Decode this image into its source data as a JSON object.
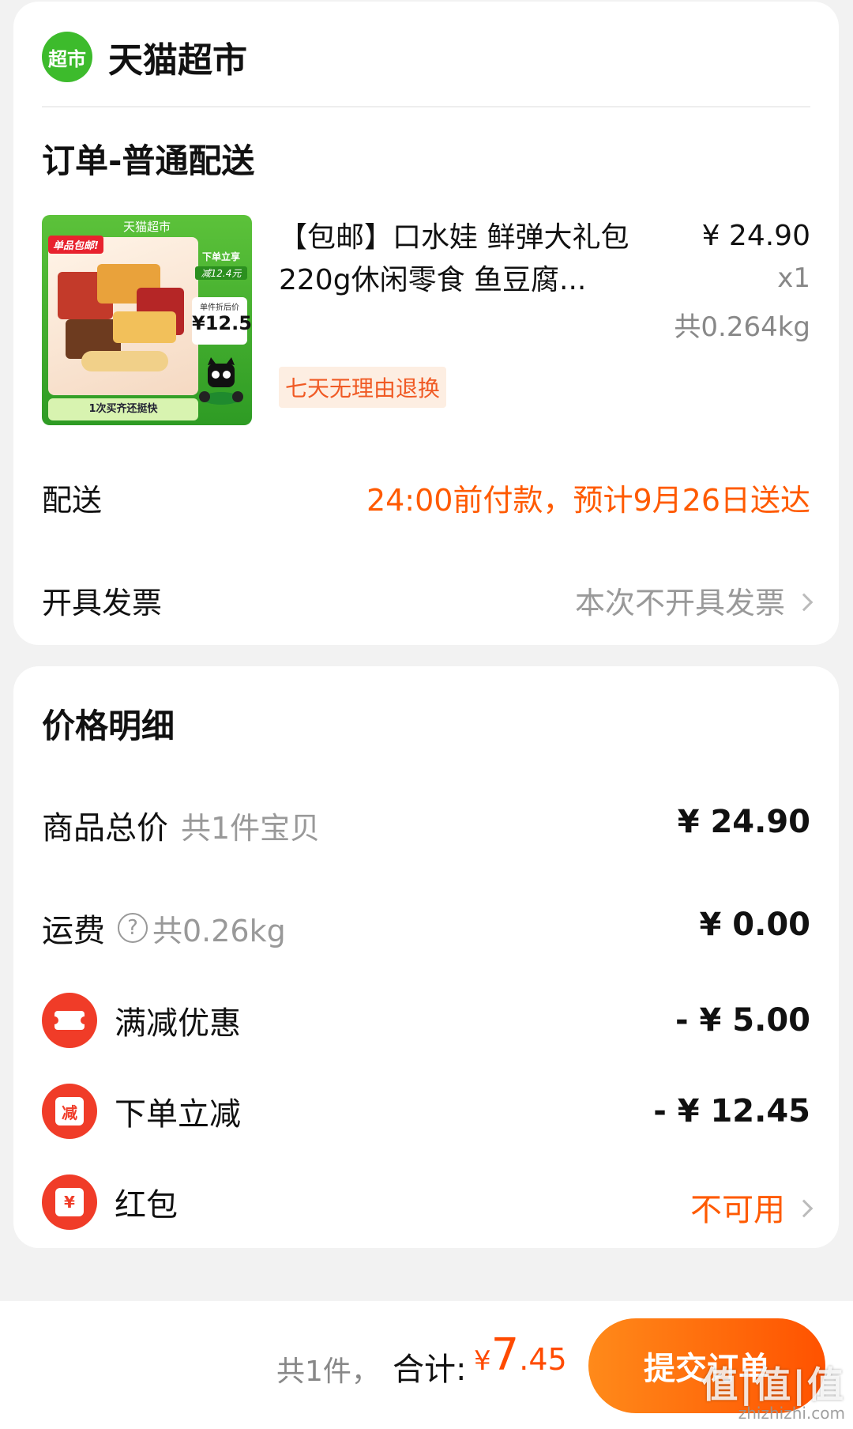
{
  "store": {
    "logo_text": "超市",
    "name": "天猫超市"
  },
  "order": {
    "section_title": "订单-普通配送",
    "product": {
      "thumb_banner": "天猫超市",
      "thumb_tag": "单品包邮!",
      "thumb_promo_line1": "下单立享",
      "thumb_promo_line2": "减12.4元",
      "thumb_price_label": "单件折后价",
      "thumb_price": "¥12.5",
      "thumb_bottom": "1次买齐还挺快",
      "title": "【包邮】口水娃 鲜弹大礼包220g休闲零食 鱼豆腐...",
      "price": "¥ 24.90",
      "quantity": "x1",
      "weight": "共0.264kg",
      "return_policy": "七天无理由退换"
    },
    "delivery": {
      "label": "配送",
      "value": "24:00前付款，预计9月26日送达"
    },
    "invoice": {
      "label": "开具发票",
      "value": "本次不开具发票"
    }
  },
  "price_detail": {
    "section_title": "价格明细",
    "goods_total": {
      "label": "商品总价",
      "sub": "共1件宝贝",
      "value": "¥ 24.90"
    },
    "shipping": {
      "label": "运费",
      "help": "?",
      "sub": "共0.26kg",
      "value": "¥ 0.00"
    },
    "full_reduction": {
      "label": "满减优惠",
      "value": "- ¥ 5.00"
    },
    "order_discount": {
      "label": "下单立减",
      "icon_text": "减",
      "value": "- ¥ 12.45"
    },
    "red_packet": {
      "label": "红包",
      "icon_text": "¥",
      "value": "不可用"
    }
  },
  "bottom_bar": {
    "count": "共1件，",
    "total_label": "合计:",
    "currency": "¥",
    "total_int": "7",
    "total_dec": ".45",
    "submit_label": "提交订单",
    "watermark_main": "值|值|值",
    "watermark_sub": "zhizhizhi.com"
  },
  "colors": {
    "accent": "#ff5a00",
    "store_green": "#3dbb2c",
    "icon_red": "#f03c28"
  }
}
